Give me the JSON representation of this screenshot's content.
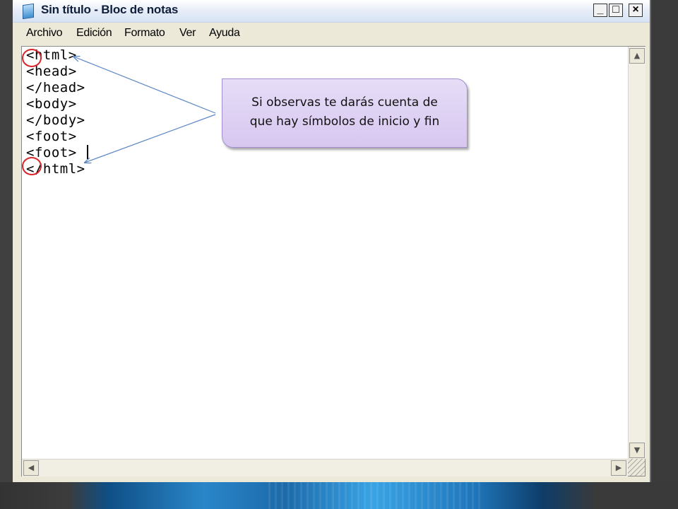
{
  "window": {
    "title": "Sin título - Bloc de notas",
    "controls": {
      "minimize": "_",
      "maximize": "□",
      "close": "×"
    }
  },
  "menu": [
    "Archivo",
    "Edición",
    "Formato",
    "Ver",
    "Ayuda"
  ],
  "editor": {
    "lines": [
      "<html>",
      "<head>",
      "</head>",
      "<body>",
      "</body>",
      "<foot>",
      "<foot>",
      "</html>"
    ]
  },
  "scrollbar": {
    "up": "▲",
    "down": "▼",
    "left": "◀",
    "right": "▶"
  },
  "callout": {
    "line1": "Si observas te darás cuenta de",
    "line2": "que hay símbolos de inicio y fin"
  },
  "colors": {
    "highlight_circle": "#d9252a",
    "callout_fill": "#ded1f3",
    "arrow": "#5b86c5"
  }
}
